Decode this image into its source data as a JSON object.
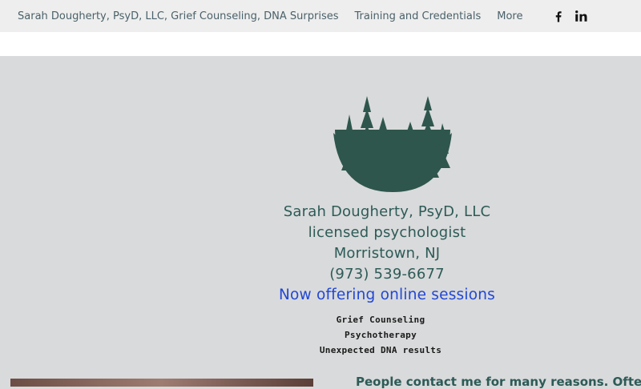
{
  "nav": {
    "items": [
      {
        "label": "Sarah Dougherty, PsyD, LLC, Grief Counseling, DNA Surprises"
      },
      {
        "label": "Training and Credentials"
      },
      {
        "label": "More"
      }
    ],
    "social": [
      "facebook-icon",
      "linkedin-icon"
    ]
  },
  "hero": {
    "name_line": "Sarah Dougherty, PsyD, LLC",
    "title_line": "licensed psychologist",
    "location_line": "Morristown, NJ",
    "phone_line": "(973) 539-6677",
    "online_line": "Now offering online sessions",
    "services": [
      "Grief Counseling",
      "Psychotherapy",
      "Unexpected DNA results"
    ],
    "intro_text": "People contact me for many reasons. Often"
  },
  "colors": {
    "accent_green": "#2d5b57",
    "online_blue": "#2047d6",
    "background": "#d9dadb"
  }
}
